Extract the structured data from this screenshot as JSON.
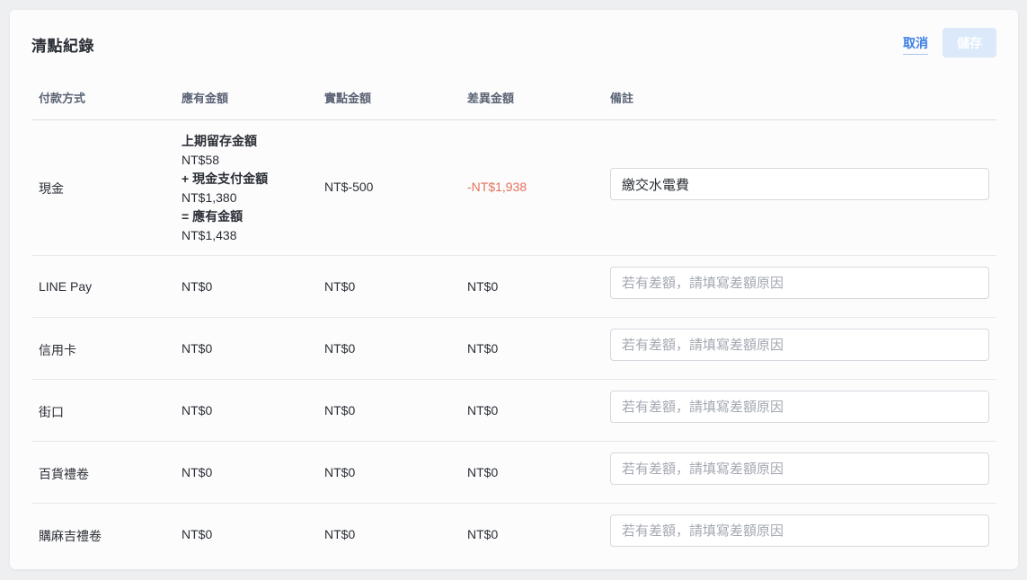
{
  "header": {
    "title": "清點紀錄",
    "cancel_label": "取消",
    "save_label": "儲存"
  },
  "table": {
    "columns": [
      "付款方式",
      "應有金額",
      "實點金額",
      "差異金額",
      "備註"
    ],
    "cash_row": {
      "method": "現金",
      "expected_breakdown": [
        {
          "label": "上期留存金額",
          "value": "NT$58"
        },
        {
          "label": "+ 現金支付金額",
          "value": "NT$1,380"
        },
        {
          "label": "= 應有金額",
          "value": "NT$1,438"
        }
      ],
      "counted": "NT$-500",
      "difference": "-NT$1,938",
      "note_value": "繳交水電費"
    },
    "rows": [
      {
        "method": "LINE Pay",
        "expected": "NT$0",
        "counted": "NT$0",
        "difference": "NT$0"
      },
      {
        "method": "信用卡",
        "expected": "NT$0",
        "counted": "NT$0",
        "difference": "NT$0"
      },
      {
        "method": "街口",
        "expected": "NT$0",
        "counted": "NT$0",
        "difference": "NT$0"
      },
      {
        "method": "百貨禮卷",
        "expected": "NT$0",
        "counted": "NT$0",
        "difference": "NT$0"
      },
      {
        "method": "購麻吉禮卷",
        "expected": "NT$0",
        "counted": "NT$0",
        "difference": "NT$0"
      }
    ],
    "note_placeholder": "若有差額，請填寫差額原因"
  },
  "colors": {
    "accent": "#3a7de3",
    "negative": "#e8715b",
    "save_disabled": "#dbe9fb"
  }
}
